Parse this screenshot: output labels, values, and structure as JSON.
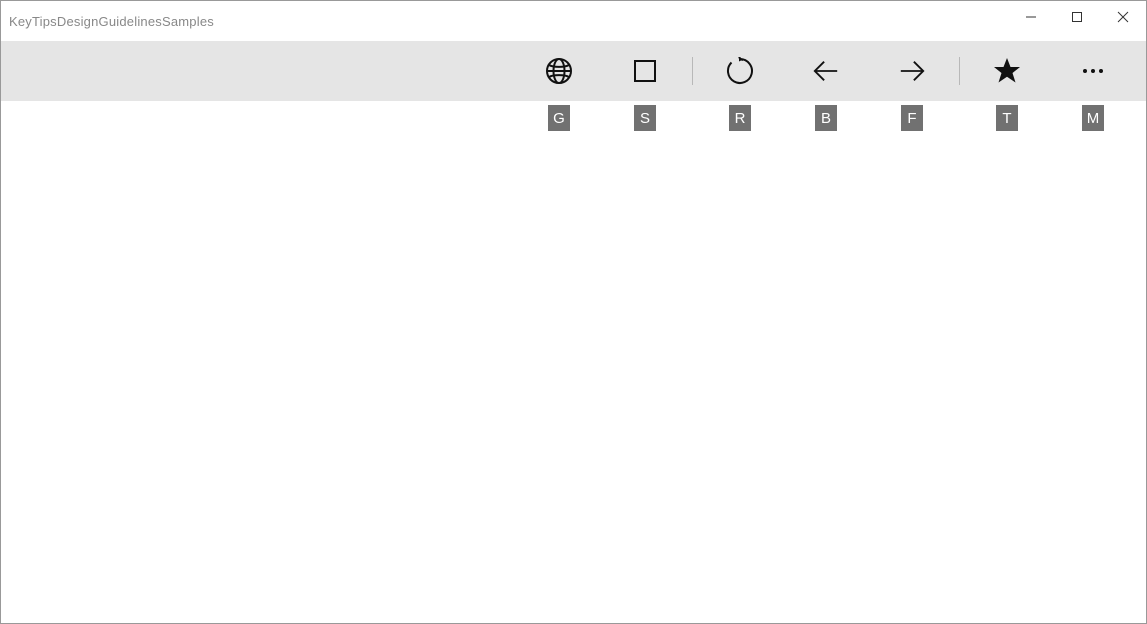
{
  "window": {
    "title": "KeyTipsDesignGuidelinesSamples"
  },
  "toolbar": {
    "items": [
      {
        "id": "globe",
        "keytip": "G"
      },
      {
        "id": "stop",
        "keytip": "S"
      },
      {
        "id": "sep1",
        "separator": true
      },
      {
        "id": "refresh",
        "keytip": "R"
      },
      {
        "id": "back",
        "keytip": "B"
      },
      {
        "id": "forward",
        "keytip": "F"
      },
      {
        "id": "sep2",
        "separator": true
      },
      {
        "id": "favorite",
        "keytip": "T"
      },
      {
        "id": "more",
        "keytip": "M"
      }
    ]
  }
}
